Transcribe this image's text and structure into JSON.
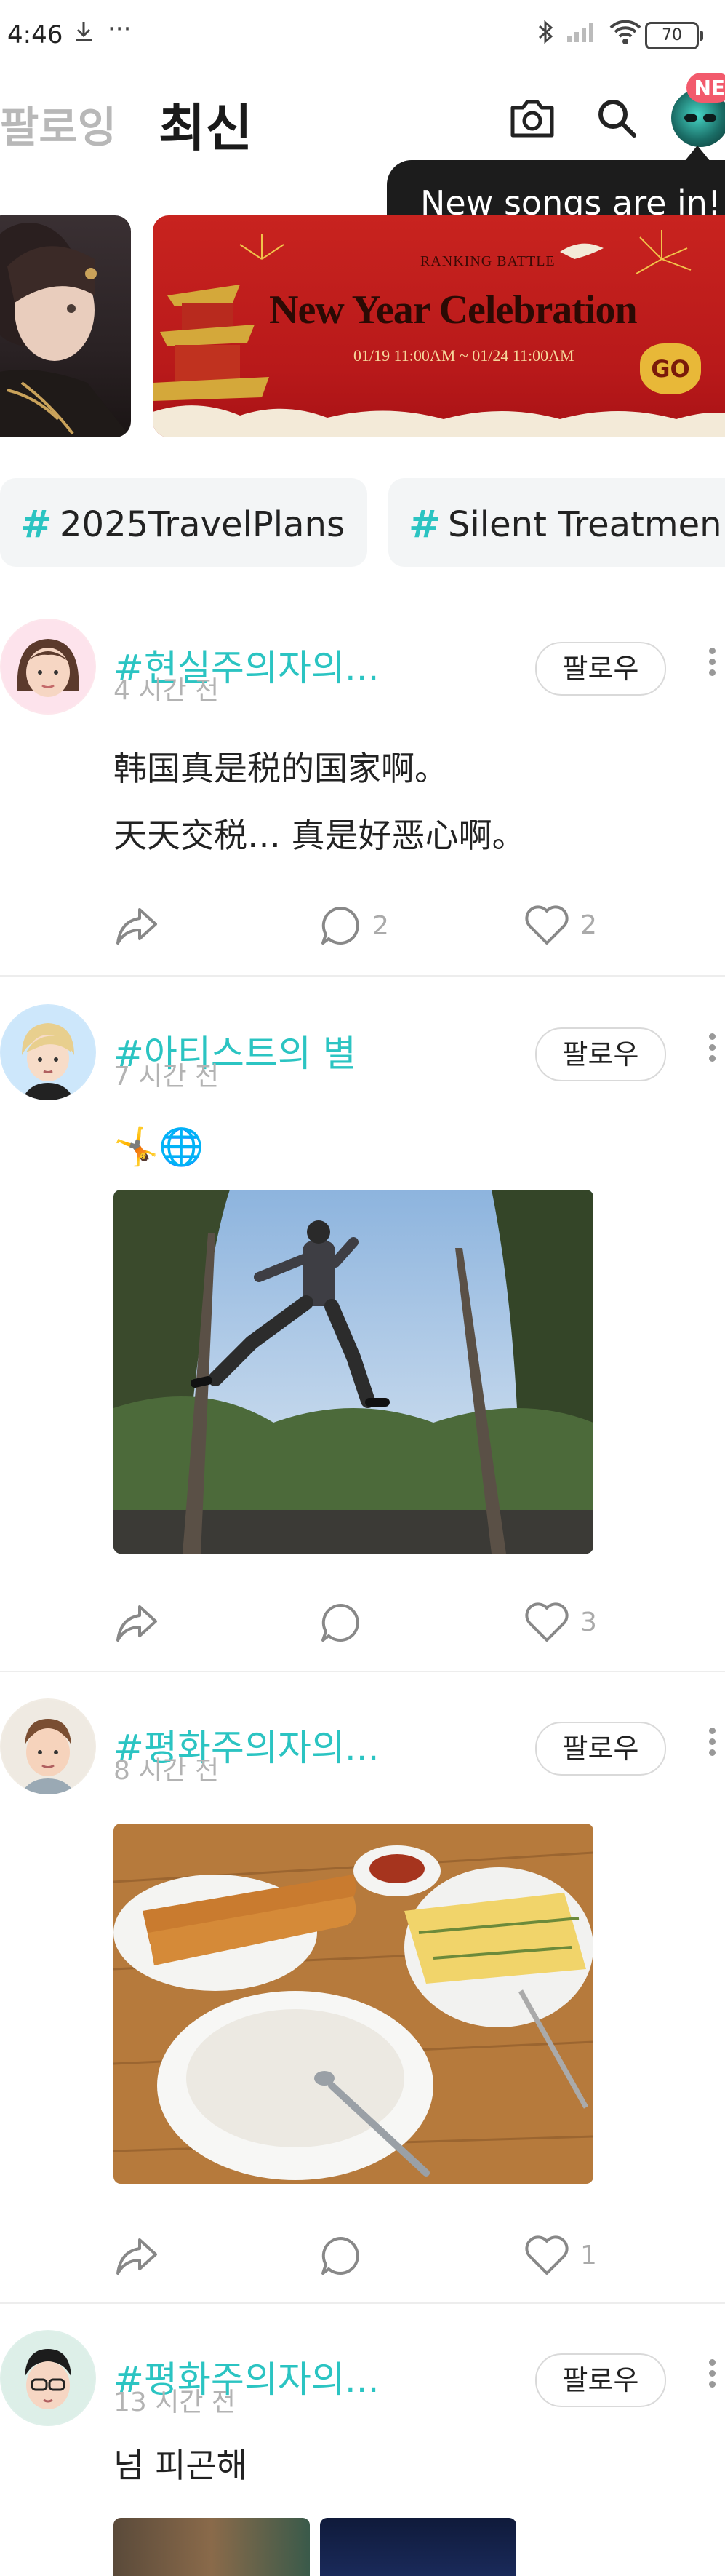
{
  "status_bar": {
    "time": "4:46",
    "battery": "70"
  },
  "header": {
    "tab_following": "팔로잉",
    "tab_latest": "최신",
    "new_badge": "NE"
  },
  "tooltip": {
    "text": "New songs are in!"
  },
  "banner": {
    "ranking": "RANKING BATTLE",
    "title": "New Year Celebration",
    "dates": "01/19 11:00AM ~ 01/24 11:00AM",
    "go": "GO"
  },
  "hashtags": [
    "2025TravelPlans",
    "Silent Treatmen"
  ],
  "follow_label": "팔로우",
  "posts": [
    {
      "title": "#현실주의자의...",
      "time": "4 시간 전",
      "lines": [
        "韩国真是税的国家啊。",
        "天天交税… 真是好恶心啊。"
      ],
      "comments": "2",
      "likes": "2"
    },
    {
      "title": "#아티스트의 별",
      "time": "7 시간 전",
      "emoji": "🤸🌐",
      "comments": "",
      "likes": "3"
    },
    {
      "title": "#평화주의자의...",
      "time": "8 시간 전",
      "comments": "",
      "likes": "1"
    },
    {
      "title": "#평화주의자의...",
      "time": "13 시간 전",
      "lines": [
        "넘 피곤해"
      ]
    }
  ],
  "colors": {
    "accent": "#2bc4c2",
    "badge": "#f25a6c"
  }
}
